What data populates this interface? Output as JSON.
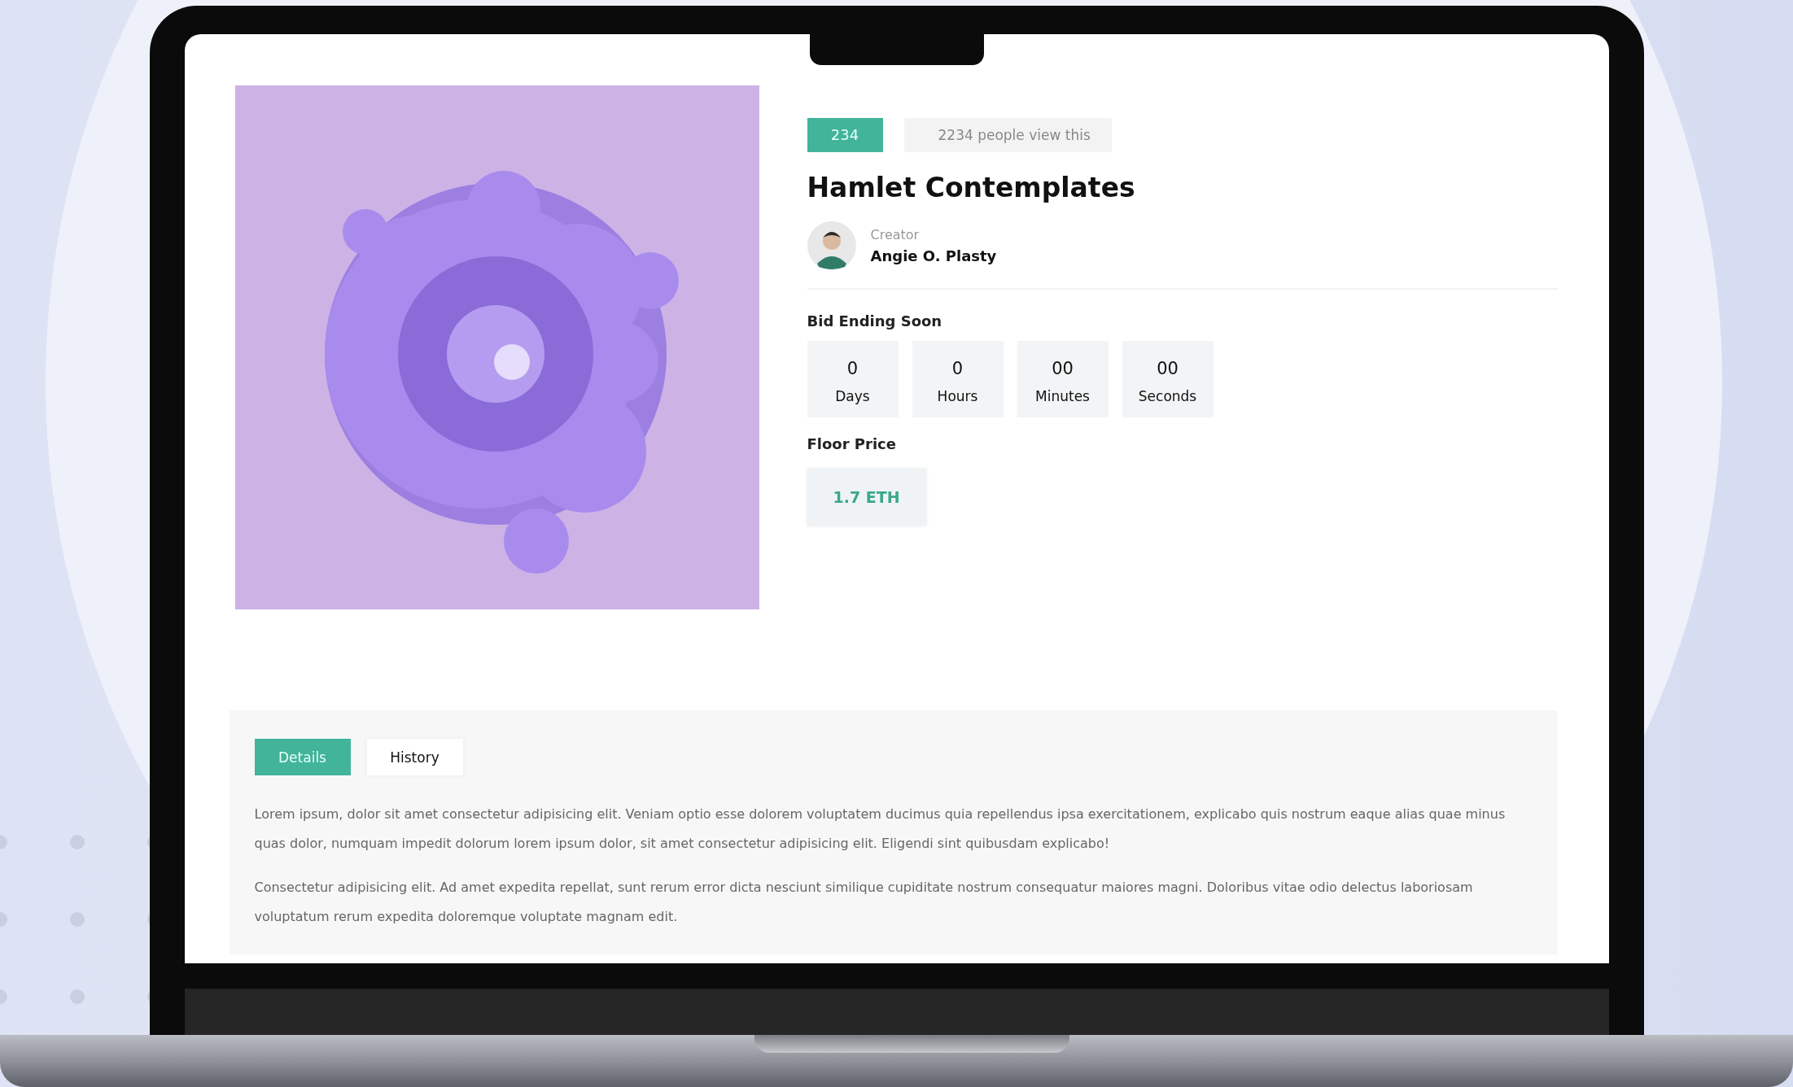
{
  "badge": "234",
  "views": "2234 people view this",
  "title": "Hamlet Contemplates",
  "creator": {
    "label": "Creator",
    "name": "Angie O. Plasty"
  },
  "countdown": {
    "heading": "Bid Ending Soon",
    "units": [
      {
        "value": "0",
        "label": "Days"
      },
      {
        "value": "0",
        "label": "Hours"
      },
      {
        "value": "00",
        "label": "Minutes"
      },
      {
        "value": "00",
        "label": "Seconds"
      }
    ]
  },
  "floor_price": {
    "label": "Floor Price",
    "value": "1.7 ETH"
  },
  "tabs": [
    {
      "label": "Details",
      "selected": true
    },
    {
      "label": "History",
      "selected": false
    }
  ],
  "paragraphs": [
    "Lorem ipsum, dolor sit amet consectetur adipisicing elit. Veniam optio esse dolorem voluptatem ducimus quia repellendus ipsa exercitationem, explicabo quis nostrum eaque alias quae minus quas dolor, numquam impedit dolorum lorem ipsum dolor, sit amet consectetur adipisicing elit. Eligendi sint quibusdam explicabo!",
    "Consectetur adipisicing elit. Ad amet expedita repellat, sunt rerum error dicta nesciunt similique cupiditate nostrum consequatur maiores magni. Doloribus vitae odio delectus laboriosam voluptatum rerum expedita doloremque voluptate magnam edit."
  ]
}
